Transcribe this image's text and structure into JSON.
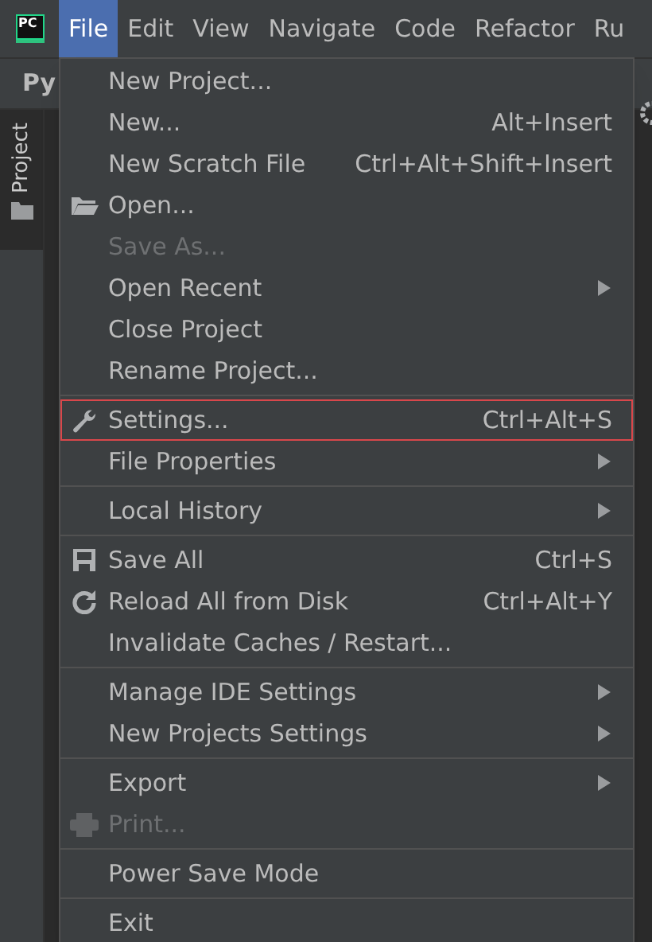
{
  "logo": {
    "text": "PC"
  },
  "menubar": [
    {
      "label": "File",
      "selected": true
    },
    {
      "label": "Edit",
      "selected": false
    },
    {
      "label": "View",
      "selected": false
    },
    {
      "label": "Navigate",
      "selected": false
    },
    {
      "label": "Code",
      "selected": false
    },
    {
      "label": "Refactor",
      "selected": false
    },
    {
      "label": "Ru",
      "selected": false
    }
  ],
  "panel_header": {
    "title": "Py"
  },
  "tool_tab": {
    "label": "Project",
    "selected": true
  },
  "menu": {
    "groups": [
      [
        {
          "label": "New Project...",
          "kind": "plain",
          "disabled": false,
          "submenu": false,
          "outlined": false
        },
        {
          "label": "New...",
          "shortcut": "Alt+Insert",
          "kind": "plain",
          "disabled": false,
          "submenu": false,
          "outlined": false
        },
        {
          "label": "New Scratch File",
          "shortcut": "Ctrl+Alt+Shift+Insert",
          "kind": "plain",
          "disabled": false,
          "submenu": false,
          "outlined": false
        },
        {
          "label": "Open...",
          "kind": "open",
          "disabled": false,
          "submenu": false,
          "outlined": false
        },
        {
          "label": "Save As...",
          "kind": "plain",
          "disabled": true,
          "submenu": false,
          "outlined": false
        },
        {
          "label": "Open Recent",
          "kind": "plain",
          "disabled": false,
          "submenu": true,
          "outlined": false
        },
        {
          "label": "Close Project",
          "kind": "plain",
          "disabled": false,
          "submenu": false,
          "outlined": false
        },
        {
          "label": "Rename Project...",
          "kind": "plain",
          "disabled": false,
          "submenu": false,
          "outlined": false
        }
      ],
      [
        {
          "label": "Settings...",
          "shortcut": "Ctrl+Alt+S",
          "kind": "settings",
          "disabled": false,
          "submenu": false,
          "outlined": true
        },
        {
          "label": "File Properties",
          "kind": "plain",
          "disabled": false,
          "submenu": true,
          "outlined": false
        }
      ],
      [
        {
          "label": "Local History",
          "kind": "plain",
          "disabled": false,
          "submenu": true,
          "outlined": false
        }
      ],
      [
        {
          "label": "Save All",
          "shortcut": "Ctrl+S",
          "kind": "save",
          "disabled": false,
          "submenu": false,
          "outlined": false
        },
        {
          "label": "Reload All from Disk",
          "shortcut": "Ctrl+Alt+Y",
          "kind": "reload",
          "disabled": false,
          "submenu": false,
          "outlined": false
        },
        {
          "label": "Invalidate Caches / Restart...",
          "kind": "plain",
          "disabled": false,
          "submenu": false,
          "outlined": false
        }
      ],
      [
        {
          "label": "Manage IDE Settings",
          "kind": "plain",
          "disabled": false,
          "submenu": true,
          "outlined": false
        },
        {
          "label": "New Projects Settings",
          "kind": "plain",
          "disabled": false,
          "submenu": true,
          "outlined": false
        }
      ],
      [
        {
          "label": "Export",
          "kind": "plain",
          "disabled": false,
          "submenu": true,
          "outlined": false
        },
        {
          "label": "Print...",
          "kind": "print",
          "disabled": true,
          "submenu": false,
          "outlined": false
        }
      ],
      [
        {
          "label": "Power Save Mode",
          "kind": "plain",
          "disabled": false,
          "submenu": false,
          "outlined": false
        }
      ],
      [
        {
          "label": "Exit",
          "kind": "plain",
          "disabled": false,
          "submenu": false,
          "outlined": false
        }
      ]
    ]
  }
}
